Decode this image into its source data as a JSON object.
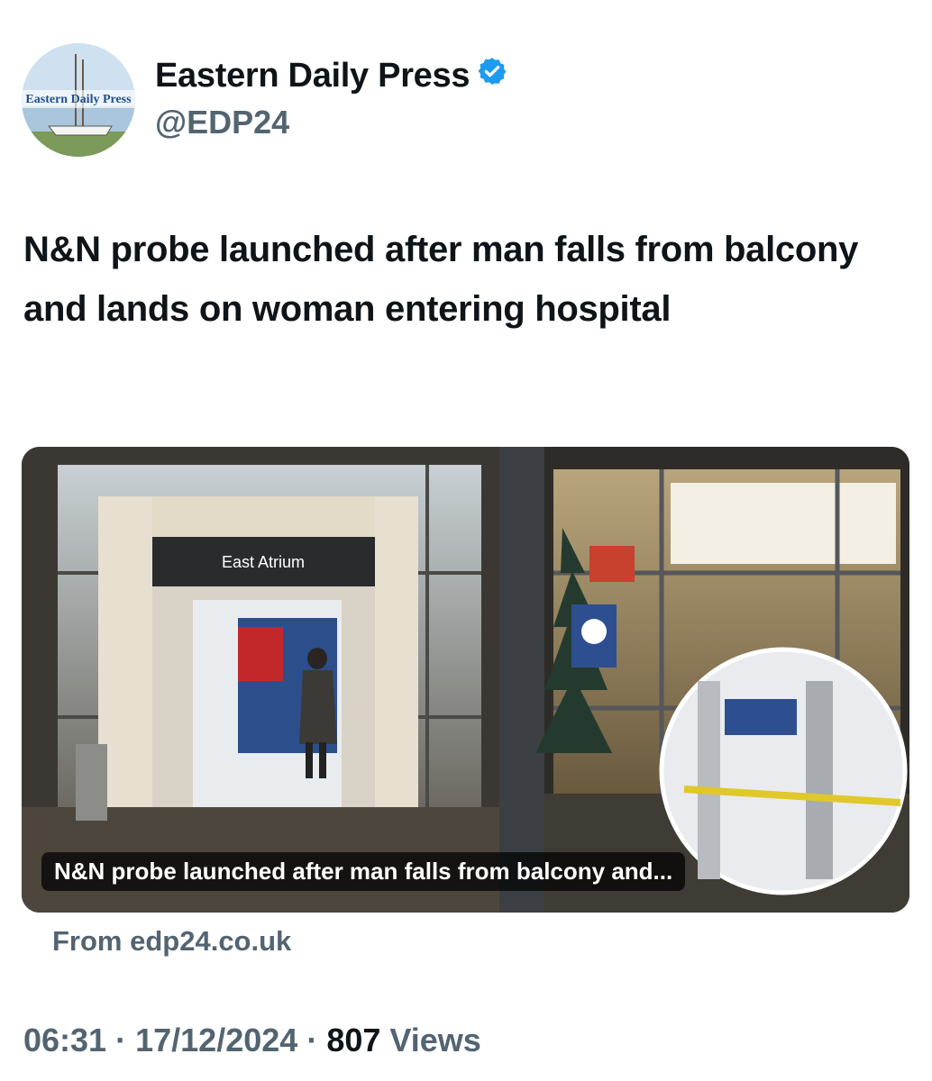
{
  "author": {
    "display_name": "Eastern Daily Press",
    "handle": "@EDP24",
    "avatar_text": "Eastern Daily Press",
    "verified_icon": "verified-badge-icon"
  },
  "tweet": {
    "text": "N&N probe launched after man falls from balcony and lands on woman entering hospital"
  },
  "link_card": {
    "image_texts": {
      "sign": "East Atrium"
    },
    "caption": "N&N probe launched after man falls from balcony and...",
    "source": "From edp24.co.uk"
  },
  "meta": {
    "time": "06:31",
    "separator": "·",
    "date": "17/12/2024",
    "views_count": "807",
    "views_label": "Views"
  },
  "colors": {
    "text_primary": "#0f1419",
    "text_secondary": "#536471",
    "verified_blue": "#1d9bf0"
  }
}
